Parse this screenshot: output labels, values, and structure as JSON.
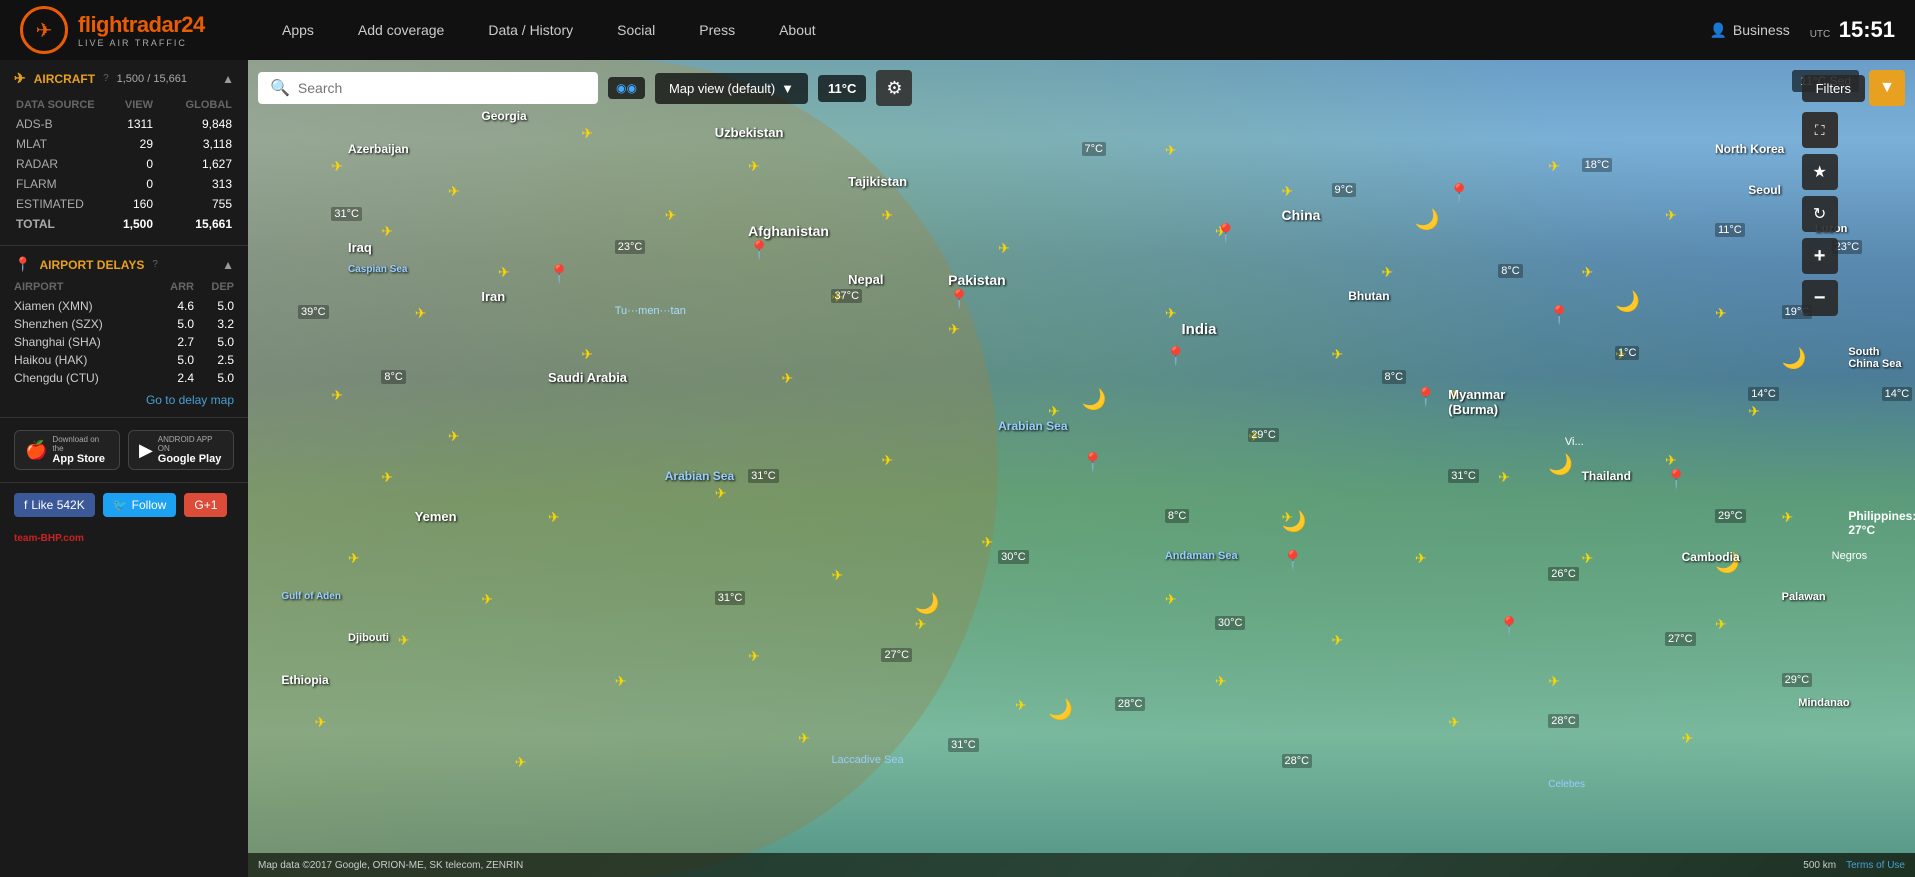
{
  "logo": {
    "title_part1": "flightradar",
    "title_part2": "24",
    "subtitle": "LIVE AIR TRAFFIC"
  },
  "nav": {
    "items": [
      "Apps",
      "Add coverage",
      "Data / History",
      "Social",
      "Press",
      "About"
    ],
    "business_label": "Business",
    "utc_label": "UTC",
    "time": "15:51"
  },
  "aircraft_panel": {
    "title": "AIRCRAFT",
    "help_text": "?",
    "count": "1,500 / 15,661",
    "data_source_header": "DATA SOURCE",
    "view_header": "VIEW",
    "global_header": "GLOBAL",
    "rows": [
      {
        "source": "ADS-B",
        "view": "1311",
        "global": "9,848"
      },
      {
        "source": "MLAT",
        "view": "29",
        "global": "3,118"
      },
      {
        "source": "RADAR",
        "view": "0",
        "global": "1,627"
      },
      {
        "source": "FLARM",
        "view": "0",
        "global": "313"
      },
      {
        "source": "ESTIMATED",
        "view": "160",
        "global": "755"
      },
      {
        "source": "TOTAL",
        "view": "1,500",
        "global": "15,661"
      }
    ]
  },
  "airport_delays": {
    "title": "AIRPORT DELAYS",
    "help_text": "?",
    "headers": {
      "airport": "AIRPORT",
      "arr": "ARR",
      "dep": "DEP"
    },
    "rows": [
      {
        "name": "Xiamen (XMN)",
        "arr": "4.6",
        "dep": "5.0"
      },
      {
        "name": "Shenzhen (SZX)",
        "arr": "5.0",
        "dep": "3.2"
      },
      {
        "name": "Shanghai (SHA)",
        "arr": "2.7",
        "dep": "5.0"
      },
      {
        "name": "Haikou (HAK)",
        "arr": "5.0",
        "dep": "2.5"
      },
      {
        "name": "Chengdu (CTU)",
        "arr": "2.4",
        "dep": "5.0"
      }
    ],
    "delay_link": "Go to delay map"
  },
  "app_badges": {
    "appstore": {
      "sub": "Download on the",
      "title": "App Store"
    },
    "googleplay": {
      "sub": "ANDROID APP ON",
      "title": "Google Play"
    }
  },
  "social": {
    "fb_label": "Like 542K",
    "tw_label": "Follow",
    "gp_label": "G+1"
  },
  "map": {
    "search_placeholder": "Search",
    "map_view_label": "Map view (default)",
    "temp_label": "11°C",
    "filters_label": "Filters",
    "footer_attribution": "Map data ©2017 Google, ORION-ME, SK telecom, ZENRIN",
    "scale_label": "500 km",
    "terms_label": "Terms of Use",
    "weather_temp": "11°C Sed"
  }
}
